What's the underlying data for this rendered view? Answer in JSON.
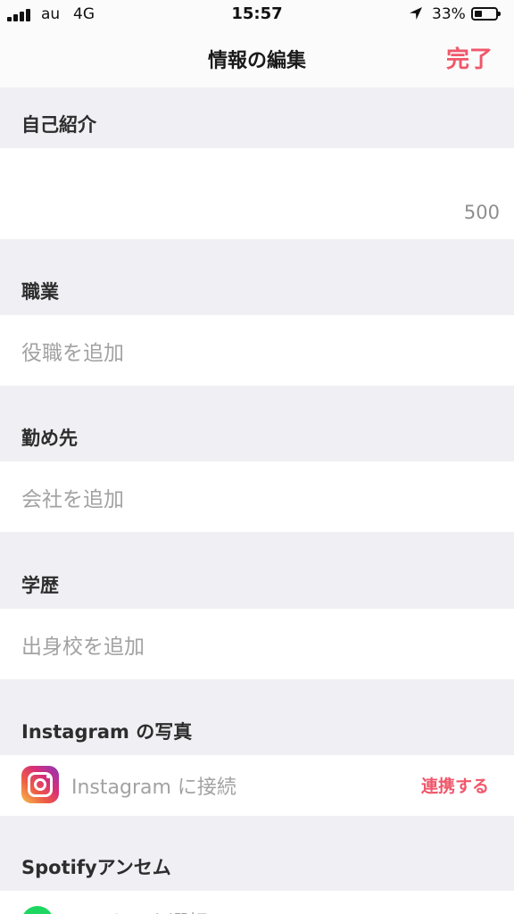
{
  "status_bar": {
    "carrier": "au",
    "network": "4G",
    "time": "15:57",
    "battery_percent": "33%",
    "battery_level": 0.33
  },
  "nav": {
    "title": "情報の編集",
    "done_label": "完了"
  },
  "sections": {
    "bio": {
      "header": "自己紹介",
      "counter": "500"
    },
    "job": {
      "header": "職業",
      "placeholder": "役職を追加"
    },
    "company": {
      "header": "勤め先",
      "placeholder": "会社を追加"
    },
    "school": {
      "header": "学歴",
      "placeholder": "出身校を追加"
    },
    "instagram": {
      "header": "Instagram の写真",
      "connect_text": "Instagram に接続",
      "link_label": "連携する"
    },
    "spotify": {
      "header": "Spotifyアンセム",
      "select_text": "アンセムを選択"
    }
  },
  "colors": {
    "accent": "#f0576a",
    "background": "#efeff4",
    "placeholder": "#a2a2a2"
  }
}
